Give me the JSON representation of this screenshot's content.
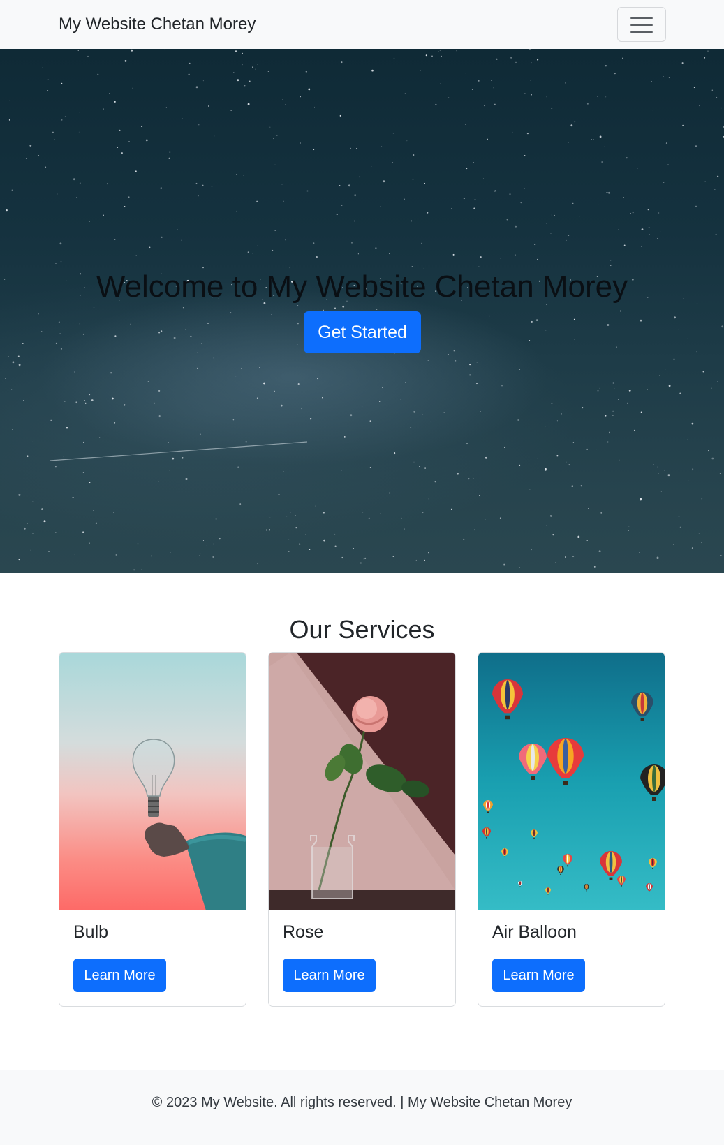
{
  "navbar": {
    "brand": "My Website Chetan Morey",
    "toggler_icon": "hamburger-menu-icon"
  },
  "hero": {
    "title": "Welcome to My Website Chetan Morey",
    "button_label": "Get Started",
    "background": "starry-night-sky-image"
  },
  "services": {
    "heading": "Our Services",
    "cards": [
      {
        "title": "Bulb",
        "button_label": "Learn More",
        "image": "hand-holding-lightbulb-image"
      },
      {
        "title": "Rose",
        "button_label": "Learn More",
        "image": "rose-in-glass-vase-image"
      },
      {
        "title": "Air Balloon",
        "button_label": "Learn More",
        "image": "hot-air-balloons-image"
      }
    ]
  },
  "footer": {
    "text": "© 2023 My Website. All rights reserved. | My Website Chetan Morey"
  },
  "colors": {
    "primary": "#0d6efd",
    "navbar_bg": "#f8f9fa",
    "footer_bg": "#f8f9fa",
    "text": "#212529"
  }
}
